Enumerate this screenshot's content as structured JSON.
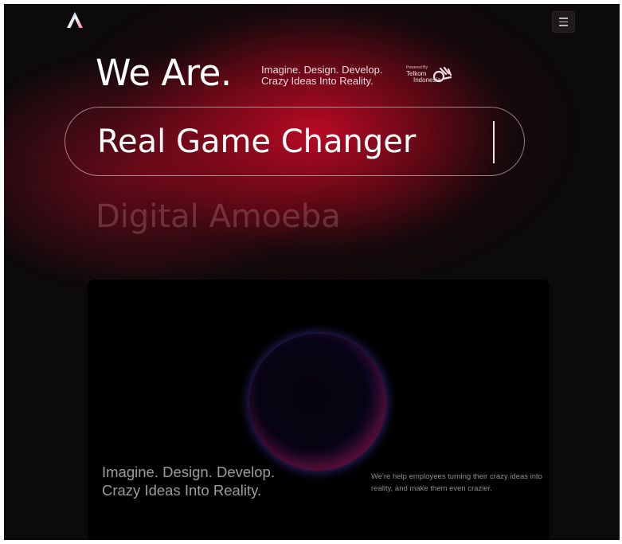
{
  "header": {
    "logo_icon": "a-logo-icon",
    "menu_icon": "hamburger-menu-icon"
  },
  "hero": {
    "headline": "We Are.",
    "tagline_line1": "Imagine. Design. Develop.",
    "tagline_line2": "Crazy Ideas Into Reality.",
    "powered_by": "Powered By",
    "partner_line1": "Telkom",
    "partner_line2": "Indonesia",
    "typed_text": "Real Game Changer",
    "next_text": "Digital Amoeba"
  },
  "card": {
    "heading_line1": "Imagine. Design. Develop.",
    "heading_line2": "Crazy Ideas Into Reality.",
    "description": "We're help employees turning their crazy ideas into reality, and make them even crazier."
  },
  "colors": {
    "background": "#0d0a0b",
    "glow": "#c40a26",
    "orb_edge": "#6a48f0"
  }
}
